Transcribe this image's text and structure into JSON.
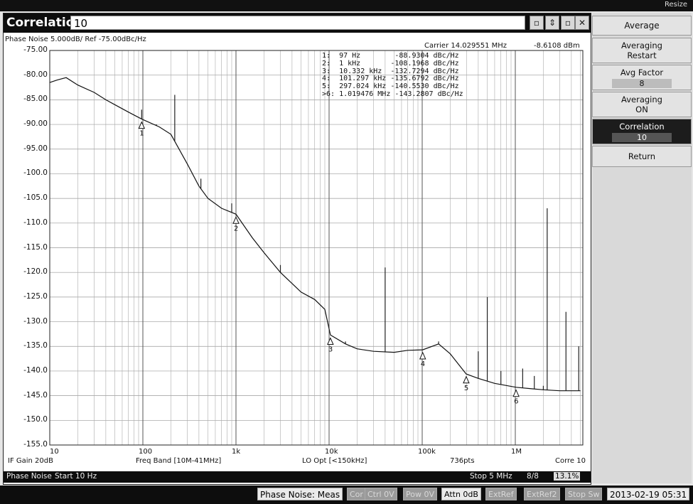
{
  "top": {
    "resize_label": "Resize"
  },
  "window": {
    "title": "Correlation",
    "value": "10"
  },
  "plot": {
    "scale_info": "Phase Noise 5.000dB/ Ref -75.00dBc/Hz",
    "carrier": "Carrier 14.029551 MHz",
    "carrier_power": "-8.6108 dBm",
    "y_ticks": [
      "-75.00",
      "-80.00",
      "-85.00",
      "-90.00",
      "-95.00",
      "-100.0",
      "-105.0",
      "-110.0",
      "-115.0",
      "-120.0",
      "-125.0",
      "-130.0",
      "-135.0",
      "-140.0",
      "-145.0",
      "-150.0",
      "-155.0"
    ],
    "x_ticks": [
      "10",
      "100",
      "1k",
      "10k",
      "100k",
      "1M"
    ],
    "markers": [
      {
        "num": "1:",
        "freq": "97 Hz",
        "value": "-88.9304 dBc/Hz"
      },
      {
        "num": "2:",
        "freq": "1 kHz",
        "value": "-108.1968 dBc/Hz"
      },
      {
        "num": "3:",
        "freq": "10.332 kHz",
        "value": "-132.7294 dBc/Hz"
      },
      {
        "num": "4:",
        "freq": "101.297 kHz",
        "value": "-135.6792 dBc/Hz"
      },
      {
        "num": "5:",
        "freq": "297.024 kHz",
        "value": "-140.5530 dBc/Hz"
      },
      {
        "num": ">6:",
        "freq": "1.019476 MHz",
        "value": "-143.2807 dBc/Hz"
      }
    ],
    "marker_labels": [
      "1",
      "2",
      "3",
      "4",
      "5",
      "6"
    ]
  },
  "chart_data": {
    "type": "line",
    "x_scale": "log",
    "xlim": [
      10,
      5000000
    ],
    "ylim": [
      -155,
      -75
    ],
    "title": "Phase Noise 5.000dB/ Ref -75.00dBc/Hz",
    "grid": true,
    "series": [
      {
        "x": [
          10,
          12,
          15,
          20,
          30,
          40,
          50,
          70,
          97,
          150,
          200,
          300,
          400,
          500,
          700,
          1000,
          1500,
          2000,
          3000,
          5000,
          7000,
          9000,
          10332,
          15000,
          20000,
          30000,
          50000,
          70000,
          101297,
          150000,
          200000,
          297024,
          400000,
          600000,
          1019476,
          1500000,
          2000000,
          3000000,
          5000000
        ],
        "y": [
          -81.5,
          -81.0,
          -80.5,
          -82.0,
          -83.5,
          -85.0,
          -86.0,
          -87.5,
          -88.9,
          -90.5,
          -92.0,
          -98.0,
          -102.5,
          -105.0,
          -107.0,
          -108.2,
          -113.0,
          -116.0,
          -120.0,
          -124.0,
          -125.5,
          -127.5,
          -132.7,
          -134.5,
          -135.5,
          -136.0,
          -136.2,
          -135.8,
          -135.7,
          -134.5,
          -136.5,
          -140.6,
          -141.5,
          -142.5,
          -143.3,
          -143.6,
          -143.8,
          -144.0,
          -144.0
        ]
      }
    ],
    "spurs": [
      {
        "x": 97,
        "y": -87.0
      },
      {
        "x": 140,
        "y": -90.0
      },
      {
        "x": 220,
        "y": -84.0
      },
      {
        "x": 420,
        "y": -101.0
      },
      {
        "x": 900,
        "y": -106.0
      },
      {
        "x": 3000,
        "y": -118.5
      },
      {
        "x": 15000,
        "y": -134.0
      },
      {
        "x": 40000,
        "y": -119.0
      },
      {
        "x": 150000,
        "y": -134.0
      },
      {
        "x": 400000,
        "y": -136.0
      },
      {
        "x": 500000,
        "y": -125.0
      },
      {
        "x": 700000,
        "y": -140.0
      },
      {
        "x": 1200000,
        "y": -139.5
      },
      {
        "x": 1600000,
        "y": -141.0
      },
      {
        "x": 2000000,
        "y": -143.0
      },
      {
        "x": 2200000,
        "y": -107.0
      },
      {
        "x": 3500000,
        "y": -128.0
      },
      {
        "x": 4800000,
        "y": -135.0
      }
    ],
    "markers": [
      {
        "label": "1",
        "x": 97,
        "y": -88.9304
      },
      {
        "label": "2",
        "x": 1000,
        "y": -108.1968
      },
      {
        "label": "3",
        "x": 10332,
        "y": -132.7294
      },
      {
        "label": "4",
        "x": 101297,
        "y": -135.6792
      },
      {
        "label": "5",
        "x": 297024,
        "y": -140.553
      },
      {
        "label": "6",
        "x": 1019476,
        "y": -143.2807
      }
    ]
  },
  "status": {
    "if_gain": "IF Gain 20dB",
    "freq_band": "Freq Band [10M-41MHz]",
    "lo_opt": "LO Opt [<150kHz]",
    "points": "736pts",
    "corre": "Corre 10",
    "mode": "Phase Noise",
    "start": "Start 10 Hz",
    "stop": "Stop 5 MHz",
    "count": "8/8",
    "percent": "13.1%"
  },
  "panel": {
    "average": "Average",
    "averaging_restart_title": "Averaging",
    "averaging_restart_sub": "Restart",
    "avg_factor_title": "Avg Factor",
    "avg_factor_value": "8",
    "averaging_on_title": "Averaging",
    "averaging_on_value": "ON",
    "correlation_title": "Correlation",
    "correlation_value": "10",
    "return": "Return"
  },
  "bottom": {
    "meas": "Phase Noise: Meas",
    "cor": "Cor",
    "ctrl": "Ctrl 0V",
    "pow": "Pow 0V",
    "attn": "Attn 0dB",
    "extref1": "ExtRef",
    "extref2": "ExtRef2",
    "stopsw": "Stop Sw",
    "datetime": "2013-02-19 05:31"
  }
}
